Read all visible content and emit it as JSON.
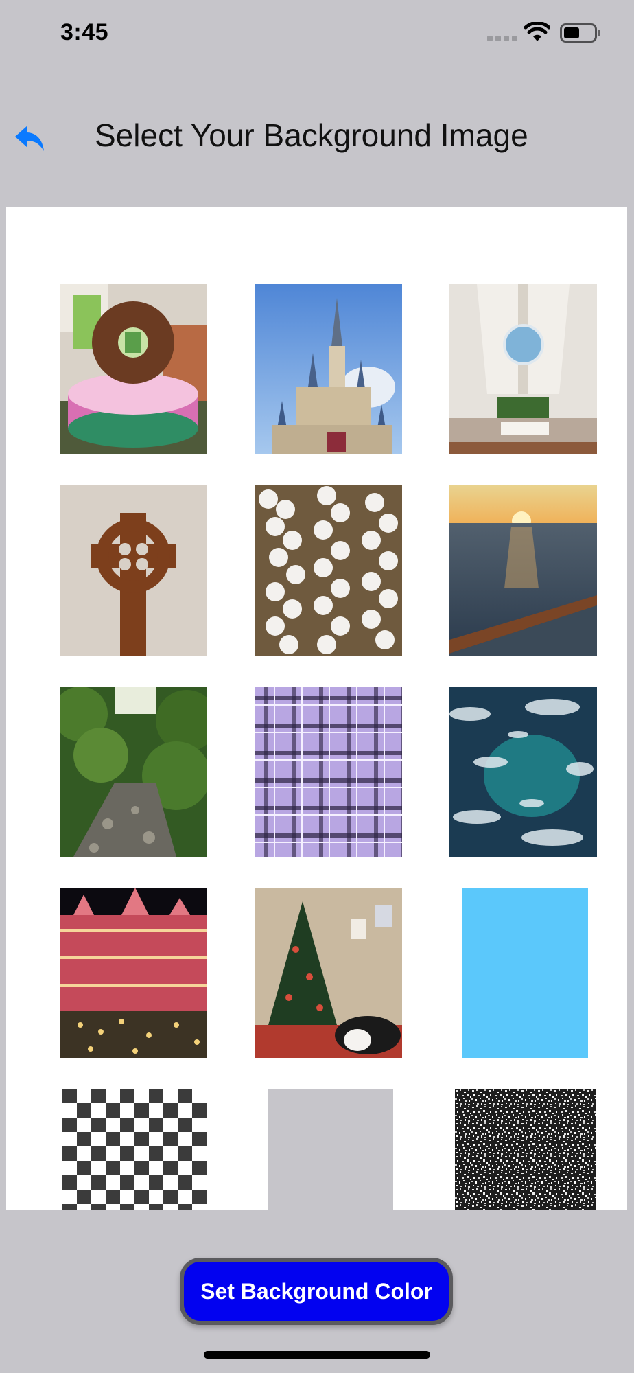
{
  "status_bar": {
    "time": "3:45",
    "icons": [
      "signal-icon",
      "wifi-icon",
      "battery-icon"
    ]
  },
  "header": {
    "title": "Select Your Background Image",
    "back_icon": "reply-arrow-icon"
  },
  "gallery": {
    "thumbnails": [
      {
        "name": "big-donut-photo"
      },
      {
        "name": "castle-photo"
      },
      {
        "name": "church-interior-photo"
      },
      {
        "name": "wooden-cross-photo"
      },
      {
        "name": "marshmallow-cookies-photo"
      },
      {
        "name": "ocean-sunset-photo"
      },
      {
        "name": "forest-stream-photo"
      },
      {
        "name": "purple-plaid-pattern"
      },
      {
        "name": "ocean-waves-photo"
      },
      {
        "name": "night-lights-castle-photo"
      },
      {
        "name": "christmas-tree-cat-photo"
      },
      {
        "name": "solid-light-blue-swatch",
        "color": "#5bc8fb"
      },
      {
        "name": "checkerboard-pattern"
      },
      {
        "name": "solid-gray-swatch",
        "color": "#c6c5ca"
      },
      {
        "name": "noise-pattern"
      }
    ]
  },
  "footer": {
    "button_label": "Set Background Color"
  },
  "colors": {
    "accent": "#0a7aff",
    "button_fill": "#0202f0",
    "button_border": "#5b5b5e",
    "background": "#c6c5ca"
  }
}
